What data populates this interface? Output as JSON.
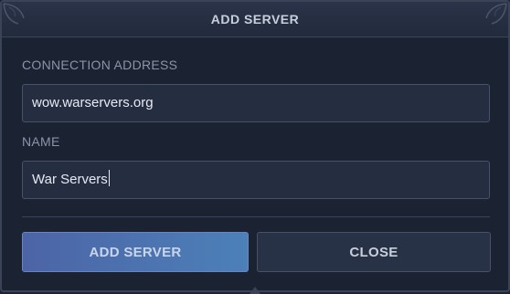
{
  "dialog": {
    "title": "ADD SERVER"
  },
  "fields": {
    "connection_address": {
      "label": "CONNECTION ADDRESS",
      "value": "wow.warservers.org"
    },
    "name": {
      "label": "NAME",
      "value": "War Servers"
    }
  },
  "buttons": {
    "add_server": "ADD SERVER",
    "close": "CLOSE"
  },
  "colors": {
    "background": "#1b2232",
    "accent": "#4c64a6",
    "text": "#c7cfdb"
  }
}
